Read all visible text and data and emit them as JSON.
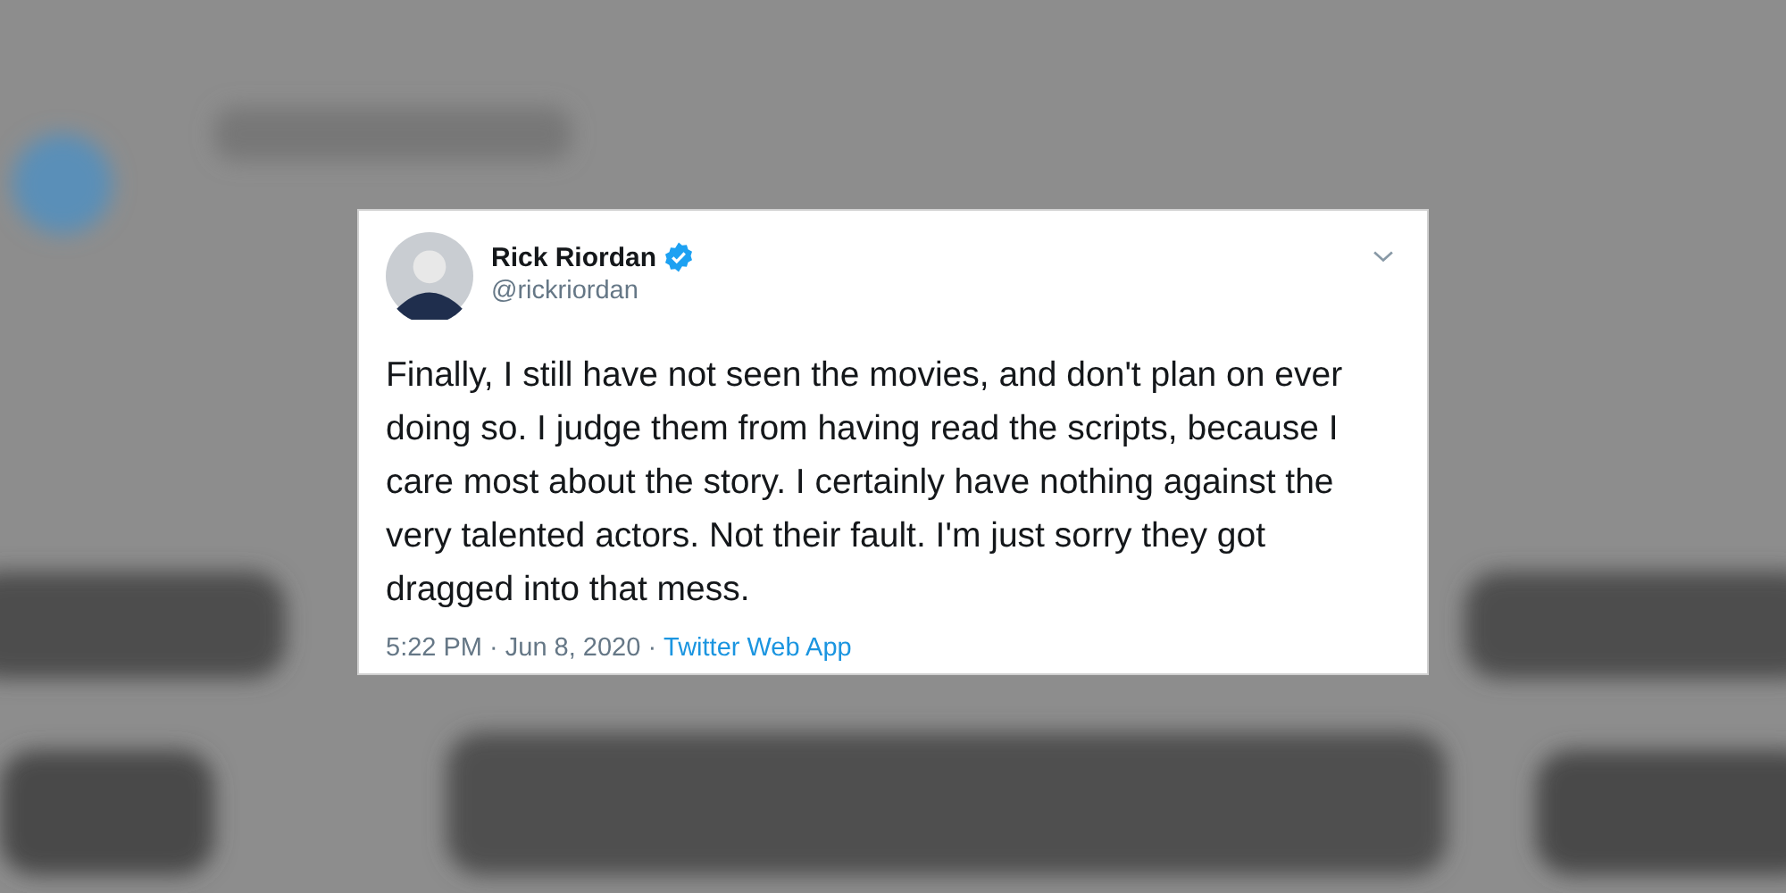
{
  "tweet": {
    "author": {
      "name": "Rick Riordan",
      "handle": "@rickriordan",
      "verified": true
    },
    "text": "Finally, I still have not seen the movies, and don't plan on ever doing so. I judge them from having read the scripts, because I care most about the story. I certainly have nothing against the very talented actors. Not their fault. I'm just sorry they got dragged into that mess.",
    "meta": "5:22 PM · Jun 8, 2020 ·",
    "source": "Twitter Web App"
  }
}
